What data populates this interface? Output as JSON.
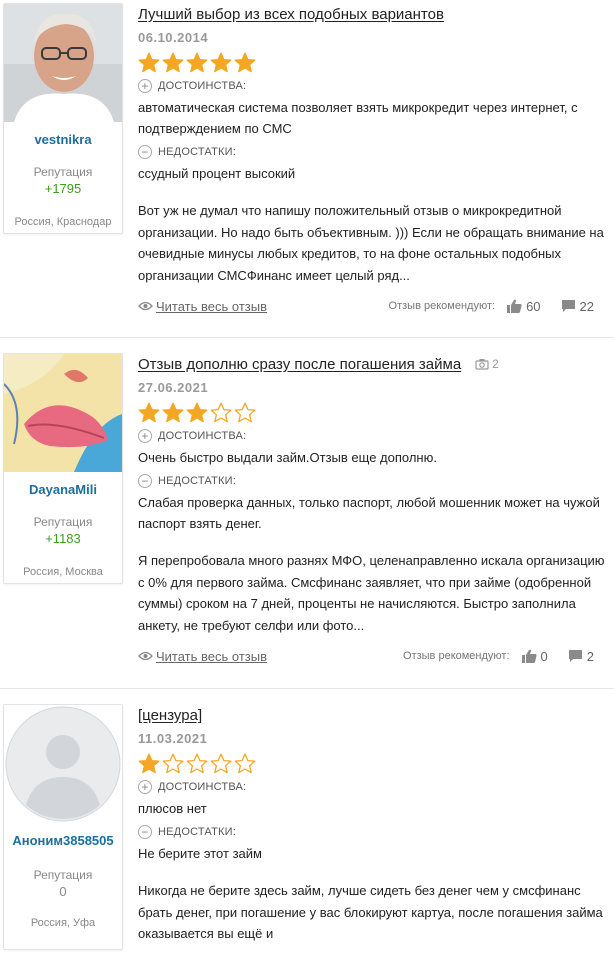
{
  "labels": {
    "pros": "ДОСТОИНСТВА:",
    "cons": "НЕДОСТАТКИ:",
    "reputation": "Репутация",
    "read_more": "Читать весь отзыв",
    "recommended": "Отзыв рекомендуют:"
  },
  "icons": {
    "star": "star-icon",
    "plus": "plus-circle-icon",
    "minus": "minus-circle-icon",
    "eye": "eye-icon",
    "like": "thumbs-up-icon",
    "comment": "comment-icon",
    "camera": "camera-icon"
  },
  "colors": {
    "star": "#f5a623",
    "username": "#1b6e9e",
    "reputation_positive": "#3c9e1c"
  },
  "reviews": [
    {
      "author": "vestnikra",
      "reputation": "+1795",
      "location": "Россия, Краснодар",
      "title": "Лучший выбор из всех подобных вариантов",
      "date": "06.10.2014",
      "rating": 5,
      "pros": "автоматическая система позволяет взять микрокредит через интернет, с подтверждением по СМС",
      "cons": "ссудный процент высокий",
      "text": "Вот уж не думал что напишу положительный отзыв о микрокредитной организации. Но надо быть объективным. ))) Если не обращать внимание на очевидные минусы любых кредитов, то на фоне остальных подобных организации СМСФинанс имеет целый ряд...",
      "likes": "60",
      "comments": "22"
    },
    {
      "author": "DayanaMili",
      "reputation": "+1183",
      "location": "Россия, Москва",
      "title": "Отзыв дополню сразу после погашения займа",
      "photos": "2",
      "date": "27.06.2021",
      "rating": 3,
      "pros": "Очень быстро выдали займ.Отзыв еще дополню.",
      "cons": "Слабая проверка данных, только паспорт, любой мошенник может на чужой паспорт взять денег.",
      "text": "Я перепробовала много разнях МФО, целенаправленно искала организацию с 0% для первого займа. Смсфинанс заявляет, что при займе (одобренной суммы) сроком на 7 дней, проценты не начисляются. Быстро заполнила анкету, не требуют селфи или фото...",
      "likes": "0",
      "comments": "2"
    },
    {
      "author": "Аноним3858505",
      "reputation": "0",
      "location": "Россия, Уфа",
      "title": "[цензура]",
      "date": "11.03.2021",
      "rating": 1,
      "pros": "плюсов нет",
      "cons": "Не берите этот займ",
      "text": "Никогда не берите здесь займ, лучше сидеть без денег чем у смсфинанс брать денег, при погашение у вас блокируют картуа, после погашения займа оказывается вы ещё и"
    }
  ]
}
